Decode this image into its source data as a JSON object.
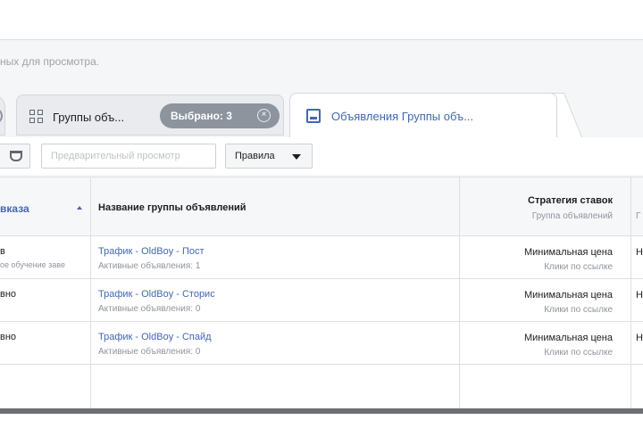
{
  "hint": "ных для просмотра.",
  "tabs": {
    "groups_label": "Группы объ...",
    "selected_badge": "Выбрано: 3",
    "badge_close": "×",
    "ads_label": "Объявления Группы объ..."
  },
  "toolbar": {
    "preview_label": "Предварительный просмотр",
    "rules_label": "Правила"
  },
  "table": {
    "headers": {
      "delivery": "вказа",
      "adset_name": "Название группы объявлений",
      "bid_strategy": "Стратегия ставок",
      "bid_strategy_sub": "Группа объявлений",
      "next_col_sub": "Г"
    },
    "rows": [
      {
        "delivery": "в",
        "delivery_sub": "ое обучение заве",
        "name": "Трафик - OldBoy - Пост",
        "active_ads": "Активные объявления: 1",
        "bid": "Минимальная цена",
        "bid_sub": "Клики по ссылке",
        "next": "Н"
      },
      {
        "delivery": "вно",
        "delivery_sub": "",
        "name": "Трафик - OldBoy - Сторис",
        "active_ads": "Активные объявления: 0",
        "bid": "Минимальная цена",
        "bid_sub": "Клики по ссылке",
        "next": "Н"
      },
      {
        "delivery": "вно",
        "delivery_sub": "",
        "name": "Трафик - OldBoy - Спайд",
        "active_ads": "Активные объявления: 0",
        "bid": "Минимальная цена",
        "bid_sub": "Клики по ссылке",
        "next": "Н"
      }
    ]
  },
  "colors": {
    "accent": "#4267b2",
    "badge": "#8d949e",
    "border": "#dddfe2"
  },
  "icons": [
    "circle-icon",
    "grid-icon",
    "close-icon",
    "ad-icon",
    "filter-icon",
    "caret-down-icon",
    "sort-up-icon"
  ]
}
